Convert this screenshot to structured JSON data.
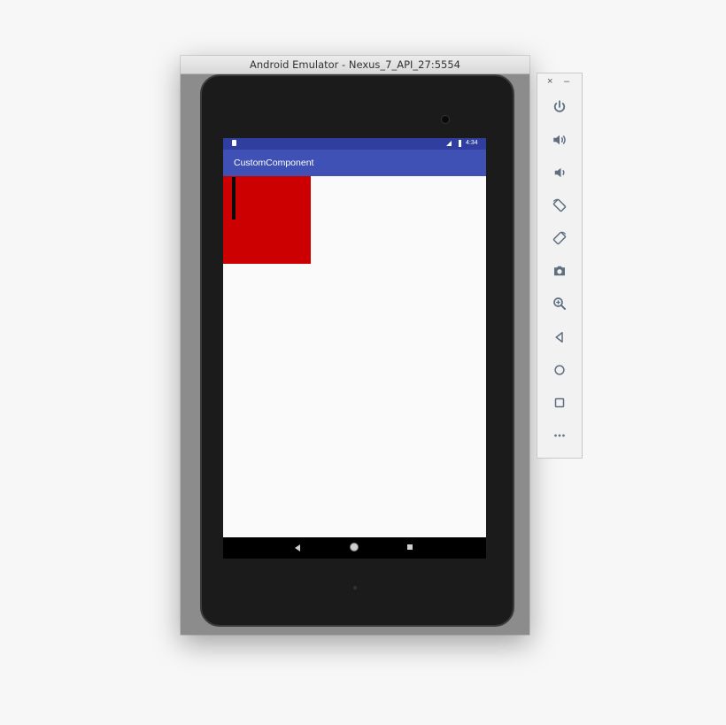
{
  "window": {
    "title": "Android Emulator - Nexus_7_API_27:5554"
  },
  "status_bar": {
    "time": "4:34"
  },
  "app": {
    "title": "CustomComponent"
  },
  "custom_view": {
    "color": "#cc0000"
  },
  "toolbar": {
    "close": "×",
    "minimize": "–",
    "buttons": [
      "power-icon",
      "volume-up-icon",
      "volume-down-icon",
      "rotate-left-icon",
      "rotate-right-icon",
      "camera-icon",
      "zoom-icon",
      "back-icon",
      "home-icon",
      "overview-icon",
      "more-icon"
    ]
  },
  "colors": {
    "status_bar": "#303f9f",
    "app_bar": "#3f51b5",
    "toolbar_icon": "#5f6f80"
  }
}
